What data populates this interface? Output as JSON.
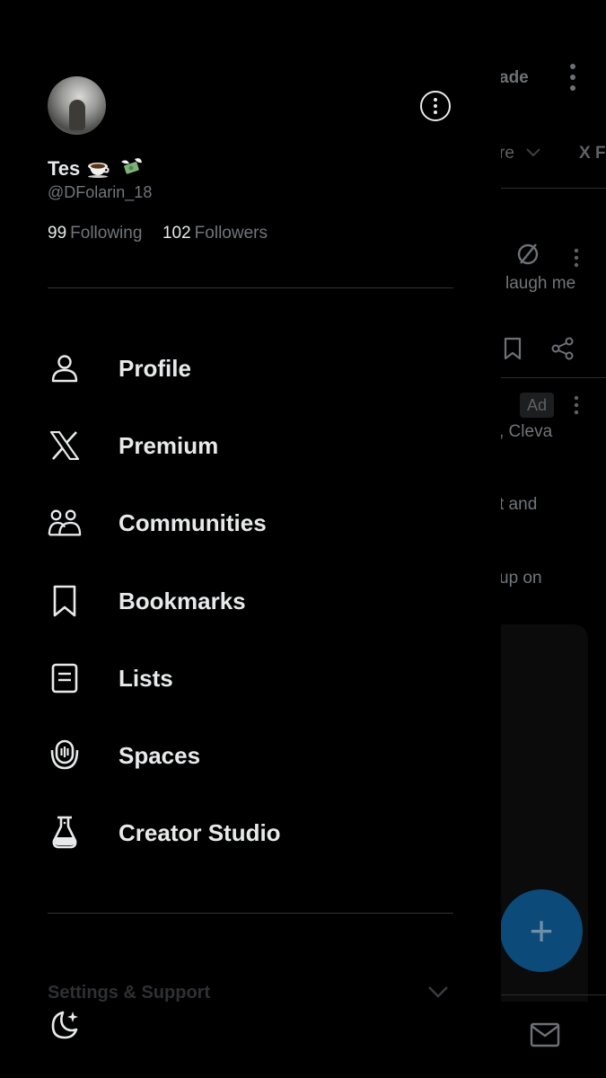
{
  "profile": {
    "display_name": "Tes",
    "emoji_names": [
      "hot-beverage-emoji",
      "money-with-wings-emoji"
    ],
    "handle": "@DFolarin_18",
    "following_count": "99",
    "following_label": "Following",
    "followers_count": "102",
    "followers_label": "Followers"
  },
  "menu": {
    "items": [
      {
        "label": "Profile",
        "icon": "person-icon"
      },
      {
        "label": "Premium",
        "icon": "x-logo-icon"
      },
      {
        "label": "Communities",
        "icon": "communities-icon"
      },
      {
        "label": "Bookmarks",
        "icon": "bookmark-icon"
      },
      {
        "label": "Lists",
        "icon": "list-icon"
      },
      {
        "label": "Spaces",
        "icon": "spaces-icon"
      },
      {
        "label": "Creator Studio",
        "icon": "flask-icon"
      }
    ],
    "settings_label": "Settings & Support"
  },
  "background_feed": {
    "upgrade_fragment": "ade",
    "tab_fragment_1": "re",
    "tab_fragment_2": "X F",
    "post1_text_fragment": "laugh me",
    "ad_badge": "Ad",
    "ad_text_1": ", Cleva",
    "ad_text_2": "t and",
    "ad_text_3": "up on"
  },
  "colors": {
    "background": "#000000",
    "text_primary": "#e7e9ea",
    "text_secondary": "#71767b",
    "fab": "#0b4a79"
  }
}
